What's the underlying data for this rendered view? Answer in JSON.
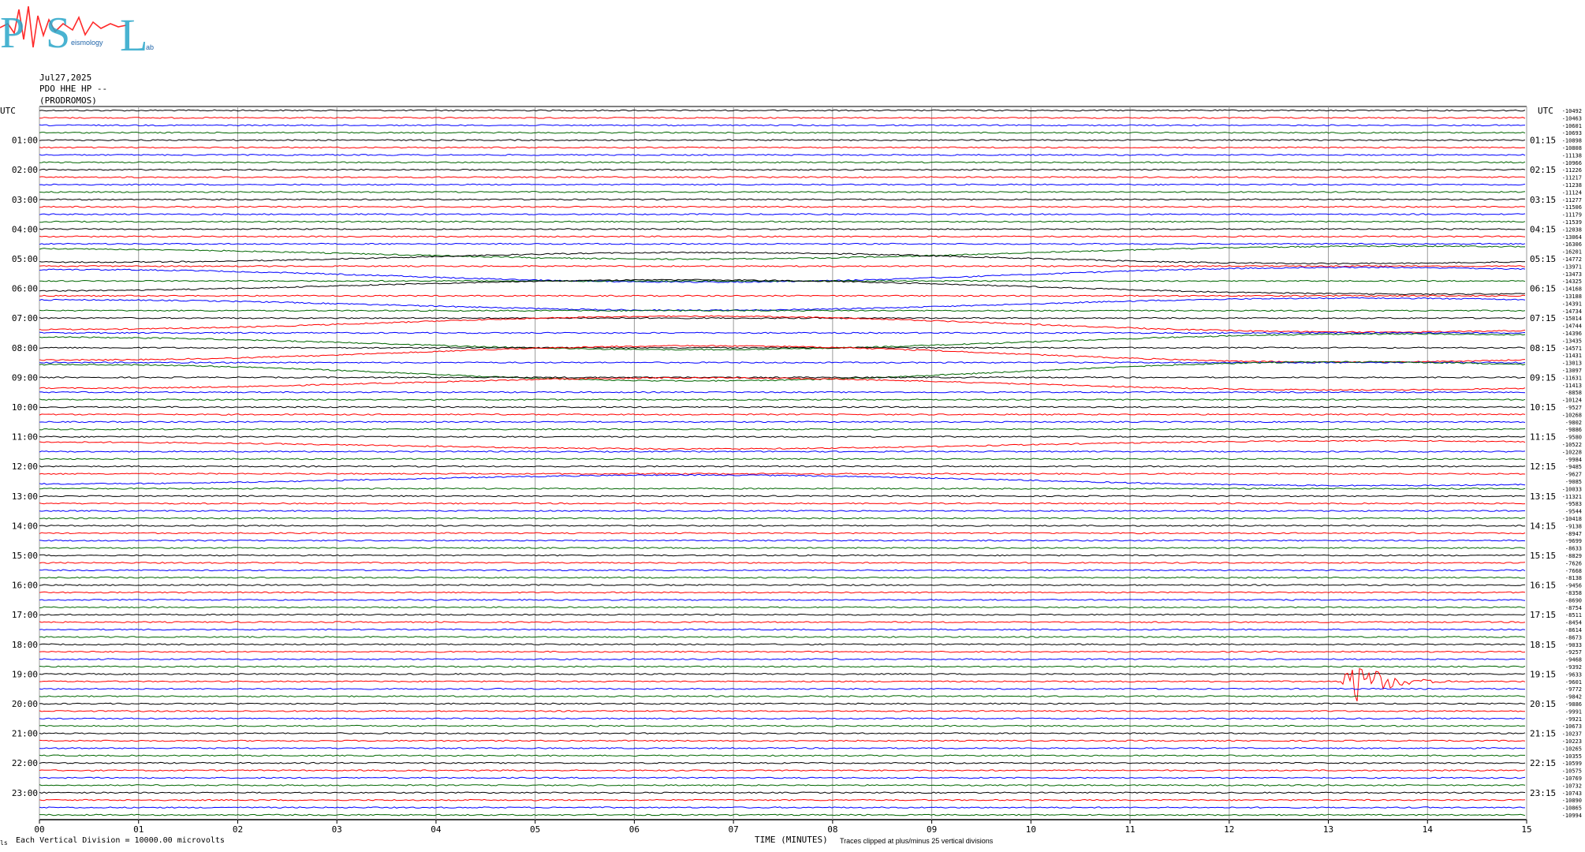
{
  "logo": {
    "letters": [
      "P",
      "S",
      "L"
    ],
    "subtitle": "eismology",
    "subtitle2": "ab",
    "colors": {
      "letters": "#2aa6c9",
      "wave": "#ff2a2a"
    }
  },
  "header": {
    "date": "Jul27,2025",
    "station": "PDO HHE HP --",
    "location": "(PRODROMOS)"
  },
  "footer": {
    "note_left": "Each Vertical Division = 10000.00 microvolts",
    "xlabel": "TIME (MINUTES)",
    "note_right": "Traces clipped at plus/minus 25 vertical divisions",
    "corner_mark": "ls"
  },
  "chart_data": {
    "type": "line",
    "title": "Jul27,2025 PDO HHE HP --",
    "xlabel": "TIME (MINUTES)",
    "ylabel_left": "UTC",
    "ylabel_right": "UTC",
    "xlim": [
      0,
      15
    ],
    "x_ticks": [
      "00",
      "01",
      "02",
      "03",
      "04",
      "05",
      "06",
      "07",
      "08",
      "09",
      "10",
      "11",
      "12",
      "13",
      "14",
      "15"
    ],
    "left_hour_labels": [
      "01:00",
      "02:00",
      "03:00",
      "04:00",
      "05:00",
      "06:00",
      "07:00",
      "08:00",
      "09:00",
      "10:00",
      "11:00",
      "12:00",
      "13:00",
      "14:00",
      "15:00",
      "16:00",
      "17:00",
      "18:00",
      "19:00",
      "20:00",
      "21:00",
      "22:00",
      "23:00"
    ],
    "right_hour_labels": [
      "01:15",
      "02:15",
      "03:15",
      "04:15",
      "05:15",
      "06:15",
      "07:15",
      "08:15",
      "09:15",
      "10:15",
      "11:15",
      "12:15",
      "13:15",
      "14:15",
      "15:15",
      "16:15",
      "17:15",
      "18:15",
      "19:15",
      "20:15",
      "21:15",
      "22:15",
      "23:15"
    ],
    "trace_minutes": 15,
    "trace_colors": [
      "#000000",
      "#ff0000",
      "#0000ff",
      "#006600"
    ],
    "trace_offsets": [
      -10492,
      -10463,
      -10601,
      -10693,
      -10898,
      -10808,
      -11138,
      -10966,
      -11226,
      -11217,
      -11238,
      -11124,
      -11277,
      -11506,
      -11179,
      -11539,
      -12038,
      -13064,
      -16306,
      -16201,
      -14772,
      -13971,
      -13473,
      -14325,
      -14168,
      -13188,
      -14391,
      -14734,
      -15014,
      -14744,
      -14396,
      -13435,
      -14571,
      -11431,
      -13013,
      -13097,
      -11631,
      -11413,
      -8858,
      -10124,
      -9527,
      -10268,
      -9802,
      -9886,
      -9580,
      -10522,
      -10228,
      -9984,
      -9485,
      -9627,
      -9085,
      -10033,
      -11321,
      -9583,
      -9544,
      -10418,
      -9138,
      -8947,
      -9699,
      -8633,
      -8829,
      -7626,
      -7668,
      -8138,
      -9456,
      -8358,
      -8690,
      -8754,
      -8511,
      -8454,
      -8614,
      -8673,
      -9033,
      -9257,
      -9468,
      -9392,
      -9633,
      -9601,
      -9772,
      -9842,
      -9886,
      -9991,
      -9921,
      -10673,
      -10237,
      -10223,
      -10265,
      -10355,
      -10599,
      -10575,
      -10769,
      -10732,
      -10743,
      -10890,
      -10865,
      -10994
    ],
    "events": [
      {
        "trace_index": 73,
        "start_minute": 13.05,
        "end_minute": 13.45,
        "amplitude_divisions": 0.6
      },
      {
        "trace_index": 77,
        "start_minute": 13.1,
        "end_minute": 14.3,
        "amplitude_divisions": 25
      },
      {
        "trace_index": 3,
        "start_minute": 13.05,
        "end_minute": 13.45,
        "amplitude_divisions": 0.5
      },
      {
        "trace_index": 87,
        "start_minute": 5.8,
        "end_minute": 6.05,
        "amplitude_divisions": 0.5
      },
      {
        "trace_index": 47,
        "start_minute": 14.65,
        "end_minute": 15.0,
        "amplitude_divisions": 0.5
      }
    ],
    "grid": "vertical-minute-lines"
  }
}
